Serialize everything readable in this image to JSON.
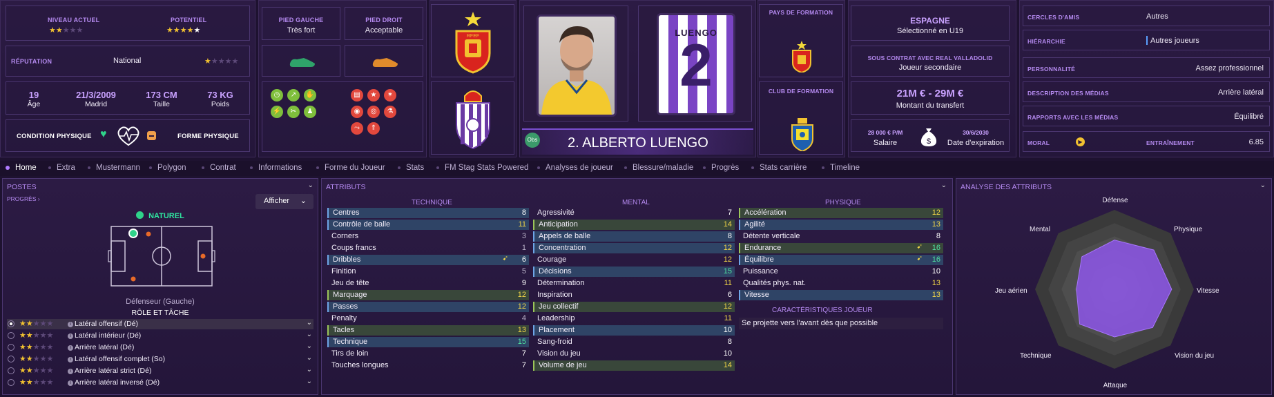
{
  "header": {
    "level": {
      "current_label": "NIVEAU ACTUEL",
      "current_stars": "★★★★★",
      "potential_label": "POTENTIEL",
      "potential_stars": "★★★★★"
    },
    "reputation": {
      "label": "RÉPUTATION",
      "value": "National",
      "stars": "★★★★★"
    },
    "basics": [
      {
        "value": "19",
        "label": "Âge"
      },
      {
        "value": "21/3/2009",
        "label": "Madrid"
      },
      {
        "value": "173 CM",
        "label": "Taille"
      },
      {
        "value": "73 KG",
        "label": "Poids"
      }
    ],
    "condition_label": "CONDITION PHYSIQUE",
    "form_label": "FORME PHYSIQUE",
    "left_foot": {
      "label": "PIED GAUCHE",
      "value": "Très fort"
    },
    "right_foot": {
      "label": "PIED DROIT",
      "value": "Acceptable"
    },
    "player_name": "2. ALBERTO LUENGO",
    "obs_label": "Obs",
    "shirt_name": "LUENGO",
    "shirt_number": "2",
    "training_country_label": "PAYS DE FORMATION",
    "training_club_label": "CLUB DE FORMATION",
    "nation": {
      "name": "ESPAGNE",
      "detail": "Sélectionné en U19"
    },
    "contract": {
      "title": "SOUS CONTRAT AVEC REAL VALLADOLID",
      "role": "Joueur secondaire"
    },
    "transfer": {
      "value": "21M € - 29M €",
      "label": "Montant du transfert"
    },
    "salary": {
      "value": "28 000 € P/M",
      "label": "Salaire"
    },
    "expiry": {
      "value": "30/6/2030",
      "label": "Date d'expiration"
    },
    "social": [
      {
        "label": "CERCLES D'AMIS",
        "value": "Autres"
      },
      {
        "label": "HIÉRARCHIE",
        "value": "Autres joueurs"
      },
      {
        "label": "PERSONNALITÉ",
        "value": "Assez professionnel"
      },
      {
        "label": "DESCRIPTION DES MÉDIAS",
        "value": "Arrière latéral"
      },
      {
        "label": "RAPPORTS AVEC LES MÉDIAS",
        "value": "Équilibré"
      }
    ],
    "morale_label": "MORAL",
    "training_label": "ENTRAÎNEMENT",
    "training_value": "6.85"
  },
  "tabs": [
    "Home",
    "Extra",
    "Mustermann",
    "Polygon",
    "Contrat",
    "Informations",
    "Forme du Joueur",
    "Stats",
    "FM Stag Stats Powered",
    "Analyses de joueur",
    "Blessure/maladie",
    "Progrès",
    "Stats carrière",
    "Timeline"
  ],
  "positions": {
    "title": "POSTES",
    "progress_link": "PROGRÈS",
    "show_button": "Afficher",
    "natural_label": "NATUREL",
    "position_name": "Défenseur (Gauche)",
    "role_title": "RÔLE ET TÂCHE",
    "roles": [
      "Latéral offensif (Dé)",
      "Latéral intérieur (Dé)",
      "Arrière latéral (Dé)",
      "Latéral offensif complet (So)",
      "Arrière latéral strict (Dé)",
      "Arrière latéral inversé (Dé)"
    ],
    "role_stars": "★★★★★"
  },
  "attributes": {
    "title": "ATTRIBUTS",
    "technical_title": "TECHNIQUE",
    "mental_title": "MENTAL",
    "physical_title": "PHYSIQUE",
    "technical": [
      {
        "name": "Centres",
        "value": "8"
      },
      {
        "name": "Contrôle de balle",
        "value": "11"
      },
      {
        "name": "Corners",
        "value": "3"
      },
      {
        "name": "Coups francs",
        "value": "1"
      },
      {
        "name": "Dribbles",
        "value": "6"
      },
      {
        "name": "Finition",
        "value": "5"
      },
      {
        "name": "Jeu de tête",
        "value": "9"
      },
      {
        "name": "Marquage",
        "value": "12"
      },
      {
        "name": "Passes",
        "value": "12"
      },
      {
        "name": "Penalty",
        "value": "4"
      },
      {
        "name": "Tacles",
        "value": "13"
      },
      {
        "name": "Technique",
        "value": "15"
      },
      {
        "name": "Tirs de loin",
        "value": "7"
      },
      {
        "name": "Touches longues",
        "value": "7"
      }
    ],
    "mental": [
      {
        "name": "Agressivité",
        "value": "7"
      },
      {
        "name": "Anticipation",
        "value": "14"
      },
      {
        "name": "Appels de balle",
        "value": "8"
      },
      {
        "name": "Concentration",
        "value": "12"
      },
      {
        "name": "Courage",
        "value": "12"
      },
      {
        "name": "Décisions",
        "value": "15"
      },
      {
        "name": "Détermination",
        "value": "11"
      },
      {
        "name": "Inspiration",
        "value": "6"
      },
      {
        "name": "Jeu collectif",
        "value": "12"
      },
      {
        "name": "Leadership",
        "value": "11"
      },
      {
        "name": "Placement",
        "value": "10"
      },
      {
        "name": "Sang-froid",
        "value": "8"
      },
      {
        "name": "Vision du jeu",
        "value": "10"
      },
      {
        "name": "Volume de jeu",
        "value": "14"
      }
    ],
    "physical": [
      {
        "name": "Accélération",
        "value": "12"
      },
      {
        "name": "Agilité",
        "value": "13"
      },
      {
        "name": "Détente verticale",
        "value": "8"
      },
      {
        "name": "Endurance",
        "value": "16"
      },
      {
        "name": "Équilibre",
        "value": "16"
      },
      {
        "name": "Puissance",
        "value": "10"
      },
      {
        "name": "Qualités phys. nat.",
        "value": "13"
      },
      {
        "name": "Vitesse",
        "value": "13"
      }
    ],
    "traits_title": "CARACTÉRISTIQUES JOUEUR",
    "trait": "Se projette vers l'avant dès que possible"
  },
  "analysis": {
    "title": "ANALYSE DES ATTRIBUTS",
    "axes": [
      "Défense",
      "Physique",
      "Vitesse",
      "Vision du jeu",
      "Attaque",
      "Technique",
      "Jeu aérien",
      "Mental"
    ]
  },
  "colors": {
    "accent": "#b58af0",
    "bg": "#1e1230",
    "purple_fill": "#8a55e0"
  }
}
